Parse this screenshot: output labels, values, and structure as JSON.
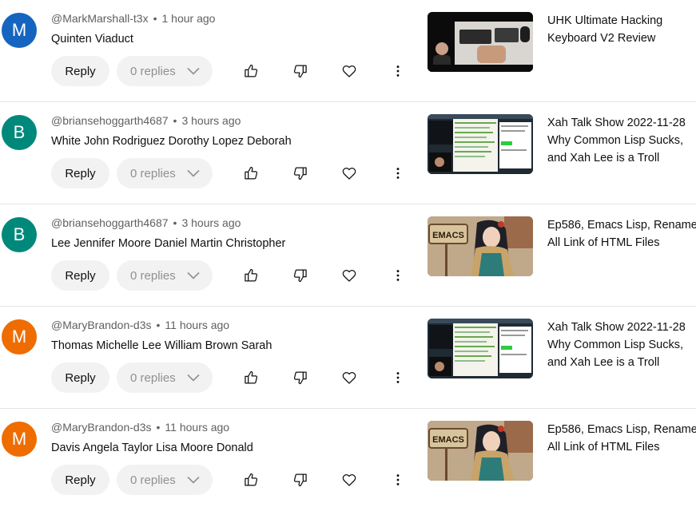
{
  "actions": {
    "reply_label": "Reply"
  },
  "comments": [
    {
      "avatar_letter": "M",
      "avatar_color": "#1565c0",
      "author": "@MarkMarshall-t3x",
      "time": "1 hour ago",
      "text": "Quinten Viaduct",
      "replies": "0 replies",
      "video_title": [
        "UHK Ultimate Hacking",
        "Keyboard V2 Review"
      ],
      "thumbnail": "keyboard-review-thumbnail"
    },
    {
      "avatar_letter": "B",
      "avatar_color": "#00897b",
      "author": "@briansehoggarth4687",
      "time": "3 hours ago",
      "text": "White John Rodriguez Dorothy Lopez Deborah",
      "replies": "0 replies",
      "video_title": [
        "Xah Talk Show 2022-11-28",
        "Why Common Lisp Sucks,",
        "and Xah Lee is a Troll"
      ],
      "thumbnail": "screen-recording-thumbnail"
    },
    {
      "avatar_letter": "B",
      "avatar_color": "#00897b",
      "author": "@briansehoggarth4687",
      "time": "3 hours ago",
      "text": "Lee Jennifer Moore Daniel Martin Christopher",
      "replies": "0 replies",
      "video_title": [
        "Ep586, Emacs Lisp, Rename",
        "All Link of HTML Files"
      ],
      "thumbnail": "emacs-illustration-thumbnail",
      "thumbnail_sign": "EMACS"
    },
    {
      "avatar_letter": "M",
      "avatar_color": "#ef6c00",
      "author": "@MaryBrandon-d3s",
      "time": "11 hours ago",
      "text": "Thomas Michelle Lee William Brown Sarah",
      "replies": "0 replies",
      "video_title": [
        "Xah Talk Show 2022-11-28",
        "Why Common Lisp Sucks,",
        "and Xah Lee is a Troll"
      ],
      "thumbnail": "screen-recording-thumbnail"
    },
    {
      "avatar_letter": "M",
      "avatar_color": "#ef6c00",
      "author": "@MaryBrandon-d3s",
      "time": "11 hours ago",
      "text": "Davis Angela Taylor Lisa Moore Donald",
      "replies": "0 replies",
      "video_title": [
        "Ep586, Emacs Lisp, Rename",
        "All Link of HTML Files"
      ],
      "thumbnail": "emacs-illustration-thumbnail",
      "thumbnail_sign": "EMACS"
    }
  ]
}
